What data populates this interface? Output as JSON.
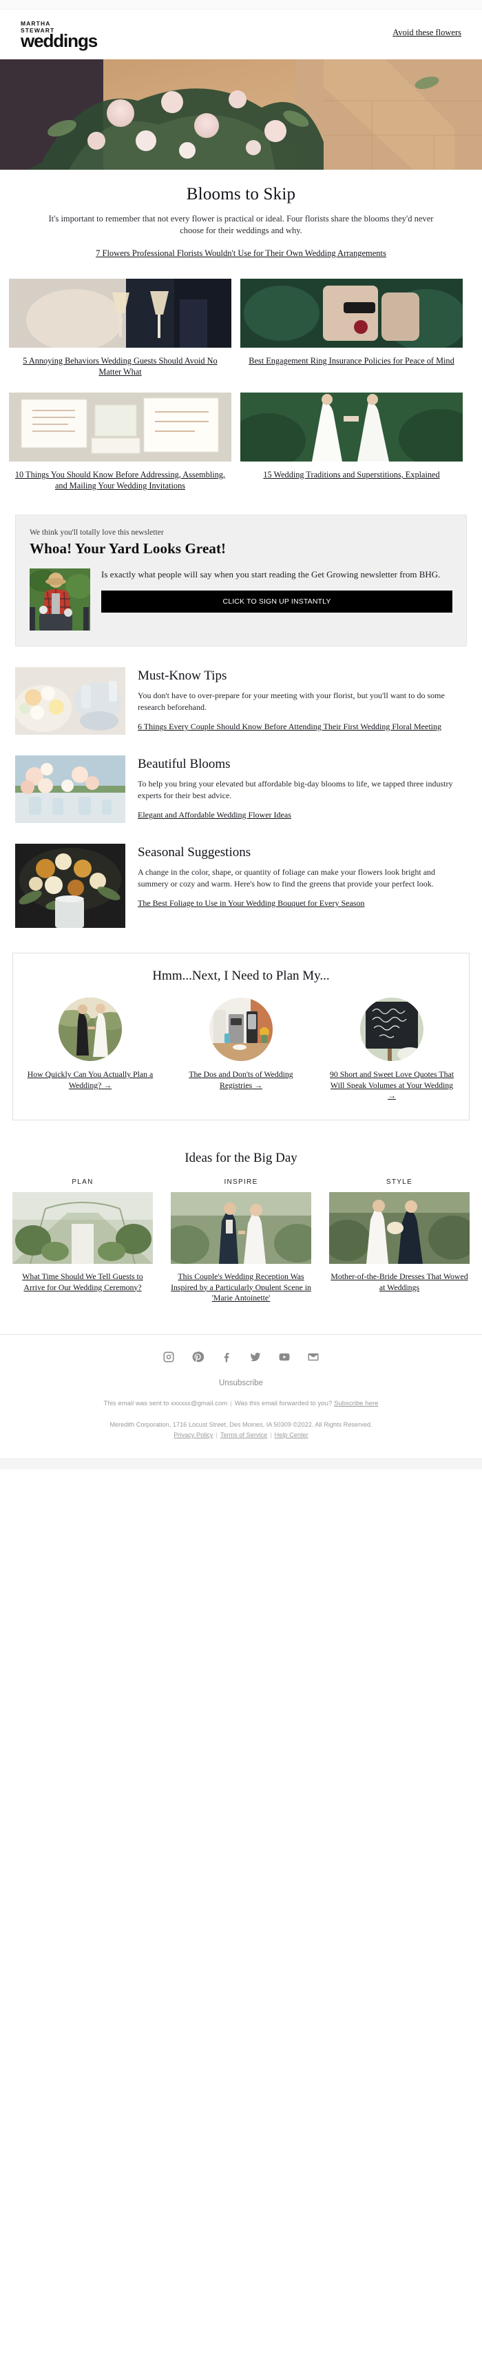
{
  "header": {
    "brand_kicker_line1": "MARTHA",
    "brand_kicker_line2": "STEWART",
    "brand_wordmark": "weddings",
    "nav_link": "Avoid these flowers"
  },
  "lede": {
    "title": "Blooms to Skip",
    "body": "It's important to remember that not every flower is practical or ideal. Four florists share the blooms they'd never choose for their weddings and why.",
    "link": "7 Flowers Professional Florists Wouldn't Use for Their Own Wedding Arrangements"
  },
  "cards_row1": [
    {
      "title": "5 Annoying Behaviors Wedding Guests Should Avoid No Matter What"
    },
    {
      "title": "Best Engagement Ring Insurance Policies for Peace of Mind"
    }
  ],
  "cards_row2": [
    {
      "title": "10 Things You Should Know Before Addressing, Assembling, and Mailing Your Wedding Invitations"
    },
    {
      "title": "15 Wedding Traditions and Superstitions, Explained"
    }
  ],
  "promo": {
    "eyebrow": "We think you'll totally love this newsletter",
    "headline": "Whoa! Your Yard Looks Great!",
    "body": "Is exactly what people will say when you start reading the Get Growing newsletter from BHG.",
    "button": "CLICK TO SIGN UP INSTANTLY"
  },
  "features": [
    {
      "title": "Must-Know Tips",
      "body": "You don't have to over-prepare for your meeting with your florist, but you'll want to do some research beforehand.",
      "link": "6 Things Every Couple Should Know Before Attending Their First Wedding Floral Meeting"
    },
    {
      "title": "Beautiful Blooms",
      "body": "To help you bring your elevated but affordable big-day blooms to life, we tapped three industry experts for their best advice.",
      "link": "Elegant and Affordable Wedding Flower Ideas"
    },
    {
      "title": "Seasonal Suggestions",
      "body": "A change in the color, shape, or quantity of foliage can make your flowers look bright and summery or cozy and warm. Here's how to find the greens that provide your perfect look.",
      "link": "The Best Foliage to Use in Your Wedding Bouquet for Every Season"
    }
  ],
  "planbox": {
    "title": "Hmm...Next, I Need to Plan My...",
    "cards": [
      {
        "label": "How Quickly Can You Actually Plan a Wedding?",
        "arrow": " →"
      },
      {
        "label": "The Dos and Don'ts of Wedding Registries",
        "arrow": " →"
      },
      {
        "label": "90 Short and Sweet Love Quotes That Will Speak Volumes at Your Wedding",
        "arrow": " →"
      }
    ]
  },
  "bigday": {
    "title": "Ideas for the Big Day",
    "cards": [
      {
        "kicker": "PLAN",
        "title": "What Time Should We Tell Guests to Arrive for Our Wedding Ceremony?"
      },
      {
        "kicker": "INSPIRE",
        "title": "This Couple's Wedding Reception Was Inspired by a Particularly Opulent Scene in 'Marie Antoinette'"
      },
      {
        "kicker": "STYLE",
        "title": "Mother-of-the-Bride Dresses That Wowed at Weddings"
      }
    ]
  },
  "footer": {
    "social": [
      {
        "name": "instagram-icon"
      },
      {
        "name": "pinterest-icon"
      },
      {
        "name": "facebook-icon"
      },
      {
        "name": "twitter-icon"
      },
      {
        "name": "youtube-icon"
      },
      {
        "name": "email-icon"
      }
    ],
    "unsubscribe": "Unsubscribe",
    "sent_to_prefix": "This email was sent to ",
    "sent_to_email": "xxxxxx@gmail.com",
    "forwarded_text": "Was this email forwarded to you?",
    "subscribe_here": "Subscribe here",
    "copyright": "Meredith Corporation, 1716 Locust Street, Des Moines, IA 50309 ©2022. All Rights Reserved.",
    "privacy": "Privacy Policy",
    "terms": "Terms of Service",
    "help": "Help Center"
  },
  "colors": {
    "accent_black": "#000000",
    "promo_bg": "#f0f0f0",
    "footer_text": "#9a9a9a"
  }
}
